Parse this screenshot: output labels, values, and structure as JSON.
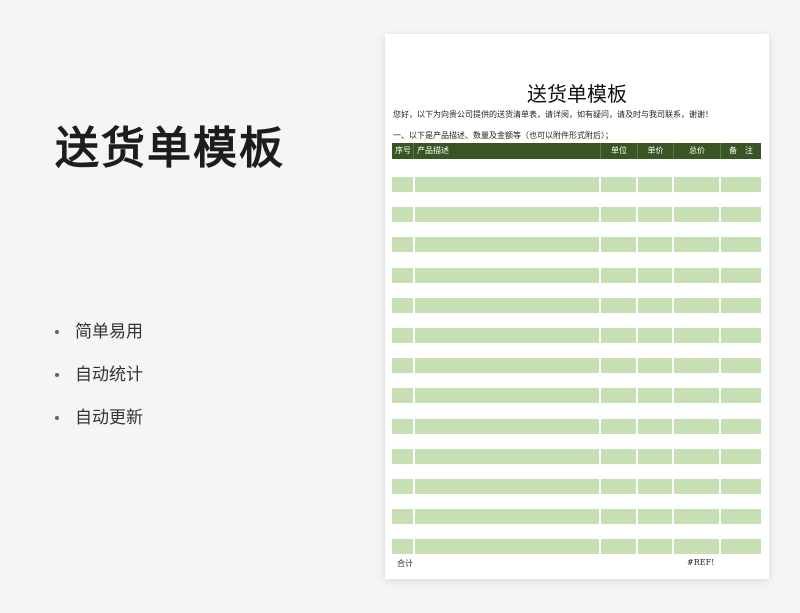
{
  "hero": {
    "title": "送货单模板",
    "features": [
      "简单易用",
      "自动统计",
      "自动更新"
    ]
  },
  "document": {
    "title": "送货单模板",
    "intro": "您好，以下为向贵公司提供的送货清单表，请详阅，如有疑问，请及时与我司联系，谢谢！",
    "note": "一、以下是产品描述、数量及金额等（也可以附件形式附后）；",
    "columns": [
      "序号",
      "产品描述",
      "单位",
      "单价",
      "总价",
      "备　注"
    ],
    "row_count": 13,
    "total_label": "合计",
    "total_value": "#REF!"
  },
  "colors": {
    "header_bg": "#375623",
    "row_fill": "#c6e0b4",
    "page_bg": "#f4f5f7"
  }
}
